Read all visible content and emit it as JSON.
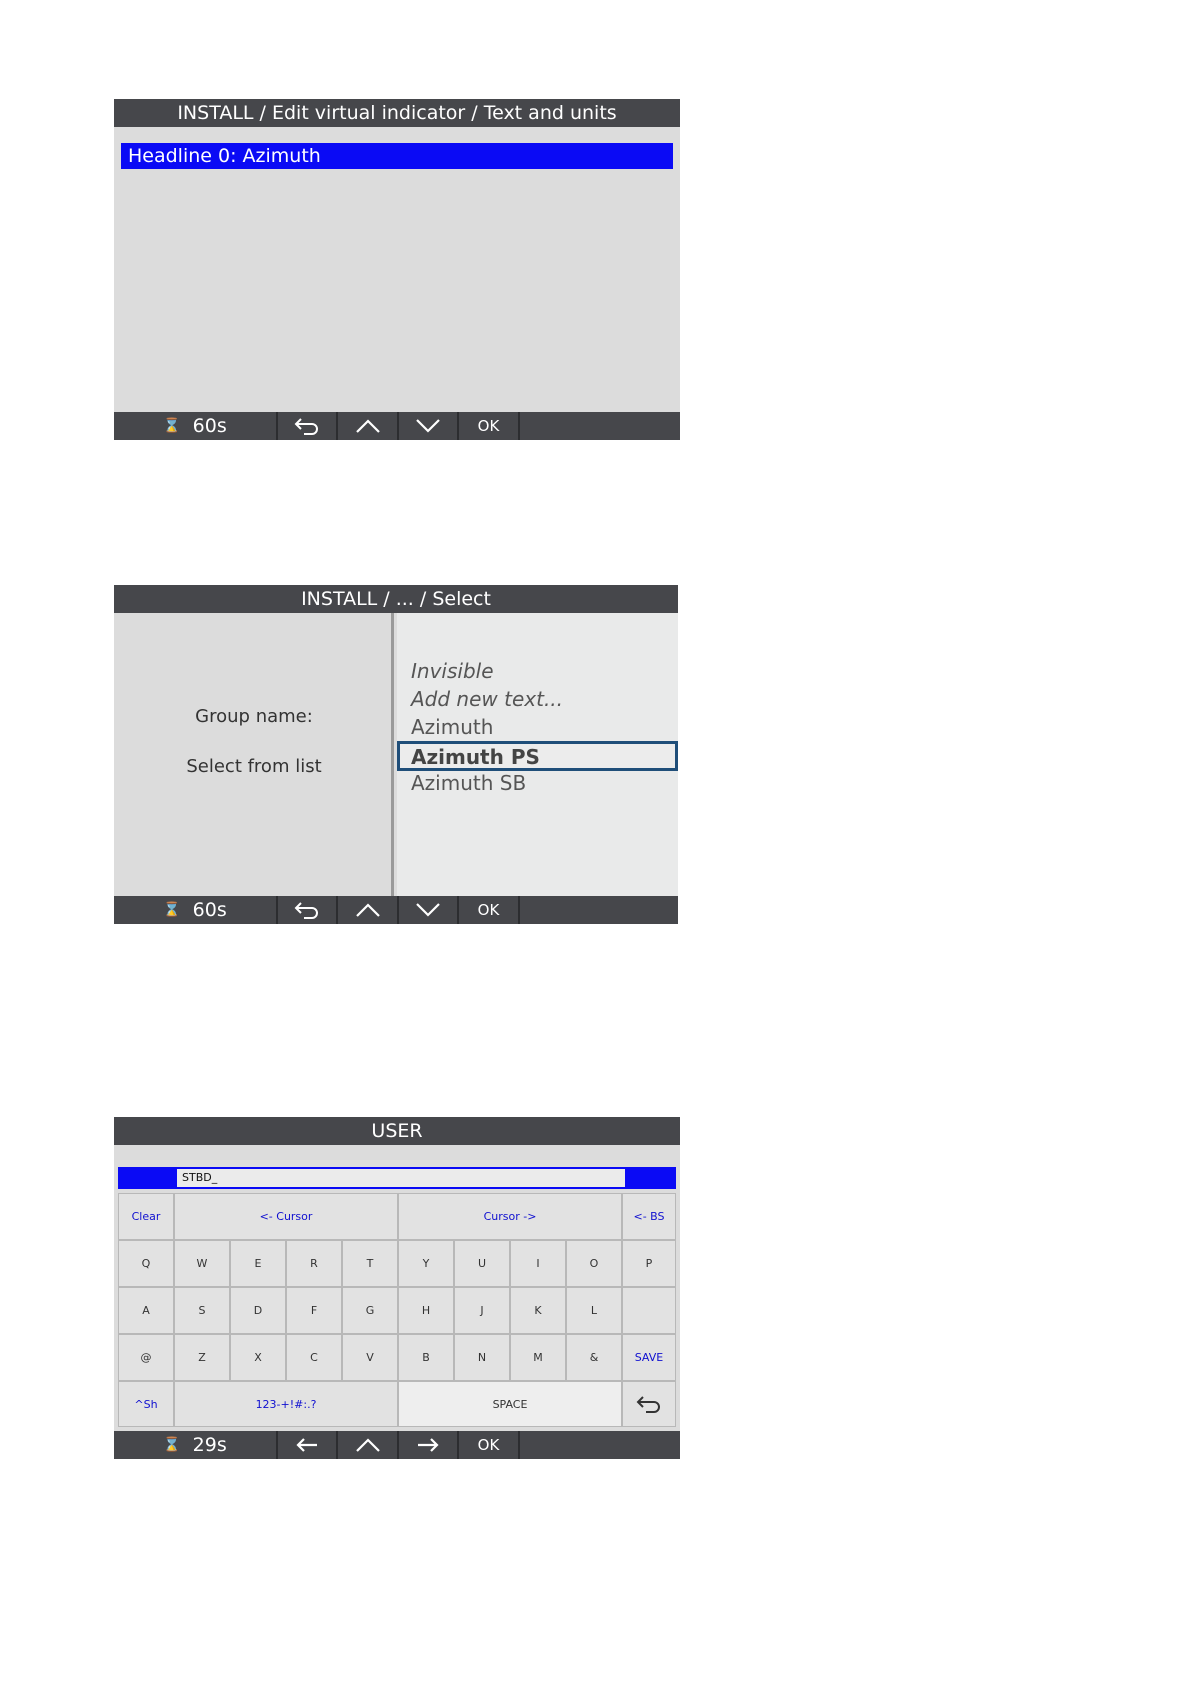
{
  "screen1": {
    "title": "INSTALL / Edit virtual indicator / Text and units",
    "selected_item": "Headline 0: Azimuth",
    "status": {
      "timer": "60s",
      "ok": "OK"
    }
  },
  "screen2": {
    "title": "INSTALL / ... / Select",
    "group_label": "Group name:",
    "instruction": "Select from list",
    "options": [
      "Invisible",
      "Add new text...",
      "Azimuth",
      "Azimuth PS",
      "Azimuth SB"
    ],
    "selected_option": "Azimuth PS",
    "status": {
      "timer": "60s",
      "ok": "OK"
    }
  },
  "screen3": {
    "title": "USER",
    "input_value": "STBD_",
    "keys": {
      "clear": "Clear",
      "cursor_left": "<- Cursor",
      "cursor_right": "Cursor ->",
      "backspace": "<- BS",
      "row1": [
        "Q",
        "W",
        "E",
        "R",
        "T",
        "Y",
        "U",
        "I",
        "O",
        "P"
      ],
      "row2": [
        "A",
        "S",
        "D",
        "F",
        "G",
        "H",
        "J",
        "K",
        "L"
      ],
      "row3": [
        "@",
        "Z",
        "X",
        "C",
        "V",
        "B",
        "N",
        "M",
        "&"
      ],
      "save": "SAVE",
      "shift": "^Sh",
      "symbols": "123-+!#:.?",
      "space": "SPACE"
    },
    "status": {
      "timer": "29s",
      "ok": "OK"
    }
  },
  "colors": {
    "title_bar": "#46474b",
    "selection_blue": "#0a0af5",
    "selected_border": "#1f4e79",
    "key_text_blue": "#1010d0"
  },
  "icons": [
    "hourglass-icon",
    "return-icon",
    "up-chevron-icon",
    "down-chevron-icon",
    "left-arrow-icon",
    "right-arrow-icon"
  ]
}
